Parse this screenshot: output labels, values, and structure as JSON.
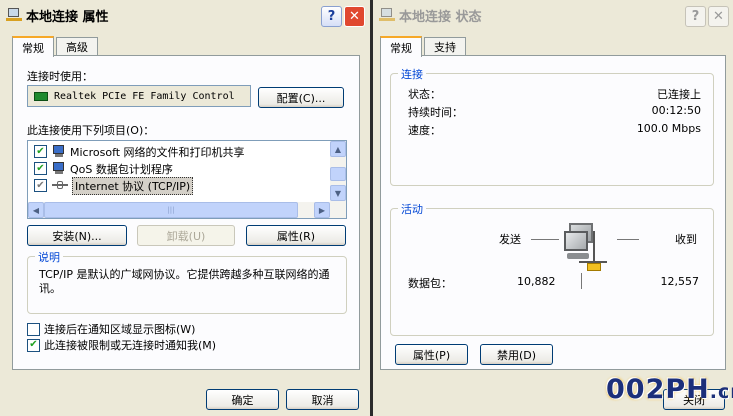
{
  "left_window": {
    "title": "本地连接  属性",
    "tabs": [
      "常规",
      "高级"
    ],
    "connect_using_label": "连接时使用：",
    "adapter_name": "Realtek PCIe FE Family Control",
    "configure_button": "配置(C)...",
    "items_label": "此连接使用下列项目(O)：",
    "items": [
      {
        "label": "Microsoft 网络的文件和打印机共享",
        "checked": true
      },
      {
        "label": "QoS 数据包计划程序",
        "checked": true
      },
      {
        "label": "Internet 协议 (TCP/IP)",
        "checked": true
      }
    ],
    "scroll_center_glyph": "|||",
    "install_button": "安装(N)...",
    "uninstall_button": "卸载(U)",
    "properties_button": "属性(R)",
    "description_title": "说明",
    "description_text": "TCP/IP 是默认的广域网协议。它提供跨越多种互联网络的通讯。",
    "show_icon_label": "连接后在通知区域显示图标(W)",
    "show_icon_checked": false,
    "notify_label": "此连接被限制或无连接时通知我(M)",
    "notify_checked": true,
    "ok_button": "确定",
    "cancel_button": "取消"
  },
  "right_window": {
    "title": "本地连接  状态",
    "tabs": [
      "常规",
      "支持"
    ],
    "connection_group": "连接",
    "status_label": "状态：",
    "status_value": "已连接上",
    "duration_label": "持续时间：",
    "duration_value": "00:12:50",
    "speed_label": "速度：",
    "speed_value": "100.0 Mbps",
    "activity_group": "活动",
    "sent_label": "发送",
    "received_label": "收到",
    "packets_label": "数据包：",
    "packets_sent": "10,882",
    "packets_received": "12,557",
    "properties_button": "属性(P)",
    "disable_button": "禁用(D)",
    "close_button_partial": "关闭"
  },
  "watermark": {
    "text": "002PH",
    "suffix": ".cn"
  },
  "colors": {
    "accent": "#f6a828",
    "group_title": "#0046d5",
    "close_btn": "#e0482f"
  },
  "icons": [
    "network-connection-icon",
    "help-icon",
    "close-icon",
    "network-adapter-icon",
    "computer-activity-icon"
  ]
}
